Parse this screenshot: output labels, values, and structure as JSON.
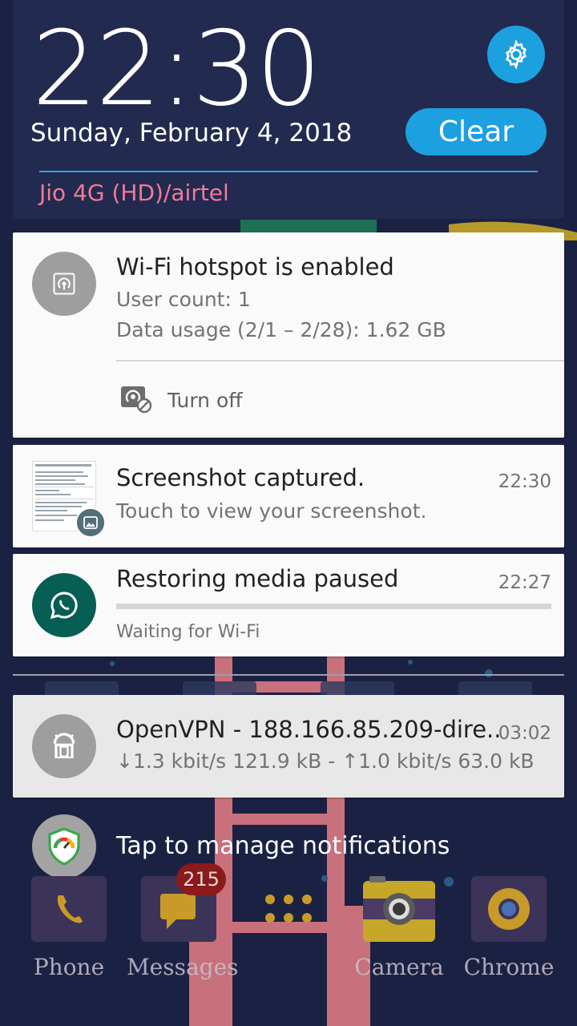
{
  "header": {
    "clock": "22:30",
    "date": "Sunday, February 4, 2018",
    "clear_label": "Clear",
    "carrier": "Jio 4G (HD)/airtel"
  },
  "notifications": {
    "hotspot": {
      "title": "Wi-Fi hotspot is enabled",
      "line1": "User count: 1",
      "line2": "Data usage (2/1 – 2/28): 1.62 GB",
      "action_label": "Turn off"
    },
    "screenshot": {
      "title": "Screenshot captured.",
      "time": "22:30",
      "text": "Touch to view your screenshot."
    },
    "whatsapp": {
      "title": "Restoring media paused",
      "time": "22:27",
      "text": "Waiting for Wi-Fi",
      "progress": 0
    },
    "vpn": {
      "title": "OpenVPN - 188.166.85.209-dire..",
      "time": "03:02",
      "text": "↓1.3 kbit/s 121.9 kB - ↑1.0 kbit/s 63.0 kB"
    }
  },
  "manage": {
    "label": "Tap to manage notifications"
  },
  "dock": {
    "items": [
      {
        "label": "Phone",
        "icon": "phone-icon"
      },
      {
        "label": "Messages",
        "icon": "messages-icon",
        "badge": "215"
      },
      {
        "label": "",
        "icon": "app-drawer-icon"
      },
      {
        "label": "Camera",
        "icon": "camera-icon"
      },
      {
        "label": "Chrome",
        "icon": "chrome-icon"
      }
    ]
  },
  "colors": {
    "accent": "#1da0e0",
    "header_bg": "#222a50",
    "carrier": "#f47a93",
    "whatsapp": "#075e54"
  }
}
